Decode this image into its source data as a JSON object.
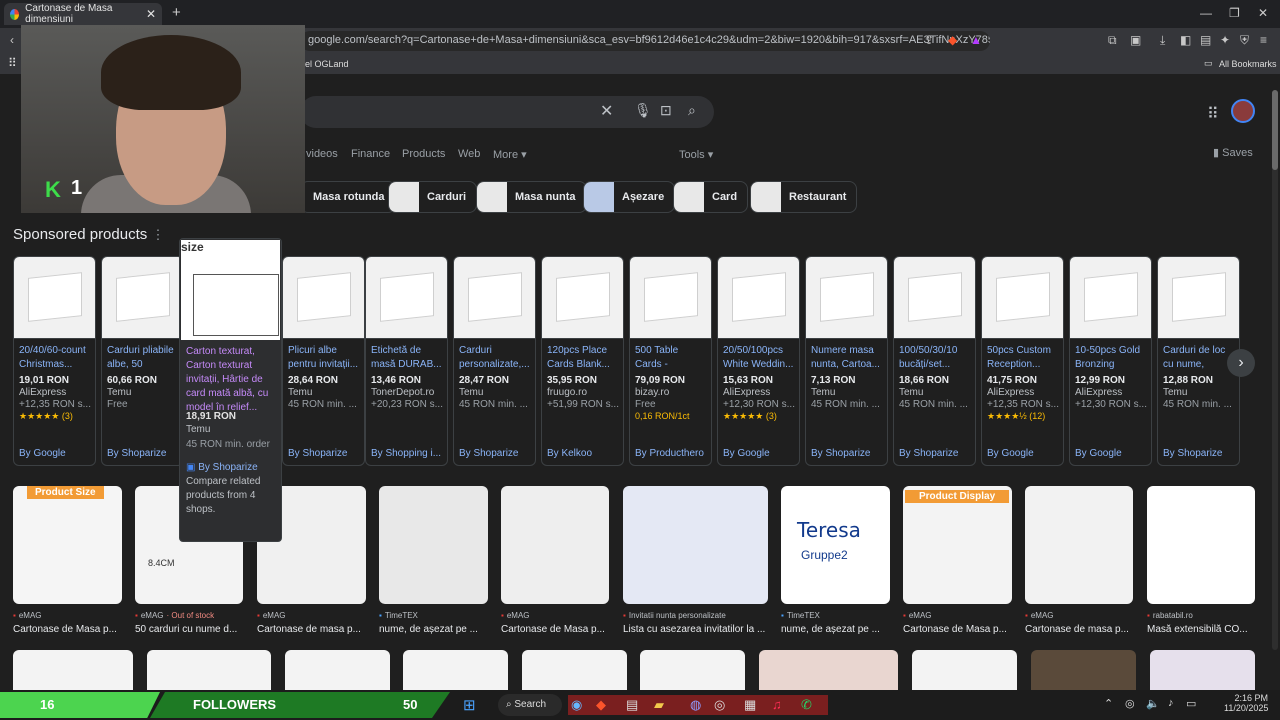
{
  "browser": {
    "tab_title": "Cartonase de Masa dimensiuni",
    "close": "✕",
    "new_tab": "+",
    "url": "google.com/search?q=Cartonase+de+Masa+dimensiuni&sca_esv=bf9612d46e1c4c29&udm=2&biw=1920&bih=917&sxsrf=AE3TifNnXzY785a-IQIX...",
    "bookmark": "el OGLand",
    "all_bookmarks": "All Bookmarks"
  },
  "filters": [
    "videos",
    "Finance",
    "Products",
    "Web",
    "More"
  ],
  "tools": "Tools",
  "saves": "Saves",
  "chips": [
    "Masa rotunda",
    "Carduri",
    "Masa nunta",
    "Așezare",
    "Card",
    "Restaurant"
  ],
  "sponsored_title": "Sponsored products",
  "popup": {
    "img_label": "size",
    "title": "Carton texturat, Carton texturat invitații, Hârtie de card mată albă, cu model în relief...",
    "price": "18,91 RON",
    "store": "Temu",
    "extra": "45 RON min. order",
    "by": "By Shoparize",
    "compare": "Compare related products from 4 shops."
  },
  "products": [
    {
      "title": "20/40/60-count Christmas...",
      "price": "19,01 RON",
      "store": "AliExpress",
      "extra": "+12,35 RON s...",
      "rating": "★★★★★ (3)",
      "by": "By Google"
    },
    {
      "title": "Carduri pliabile albe, 50 bucăți...",
      "price": "60,66 RON",
      "store": "Temu",
      "extra": "Free",
      "rating": "",
      "by": "By Shoparize"
    },
    {
      "title": "Plicuri albe pentru invitații...",
      "price": "28,64 RON",
      "store": "Temu",
      "extra": "45 RON min. ...",
      "rating": "",
      "by": "By Shoparize"
    },
    {
      "title": "Etichetă de masă DURAB...",
      "price": "13,46 RON",
      "store": "TonerDepot.ro",
      "extra": "+20,23 RON s...",
      "rating": "",
      "by": "By Shopping i..."
    },
    {
      "title": "Carduri personalizate,...",
      "price": "28,47 RON",
      "store": "Temu",
      "extra": "45 RON min. ...",
      "rating": "",
      "by": "By Shoparize"
    },
    {
      "title": "120pcs Place Cards Blank...",
      "price": "35,95 RON",
      "store": "fruugo.ro",
      "extra": "+51,99 RON s...",
      "rating": "",
      "by": "By Kelkoo"
    },
    {
      "title": "500 Table Cards - Cardstock...",
      "price": "79,09 RON",
      "store": "bizay.ro",
      "extra": "Free",
      "rating": "0,16 RON/1ct",
      "by": "By Producthero"
    },
    {
      "title": "20/50/100pcs White Weddin...",
      "price": "15,63 RON",
      "store": "AliExpress",
      "extra": "+12,30 RON s...",
      "rating": "★★★★★ (3)",
      "by": "By Google"
    },
    {
      "title": "Numere masa nunta, Cartoa...",
      "price": "7,13 RON",
      "store": "Temu",
      "extra": "45 RON min. ...",
      "rating": "",
      "by": "By Shoparize"
    },
    {
      "title": "100/50/30/10 bucăți/set...",
      "price": "18,66 RON",
      "store": "Temu",
      "extra": "45 RON min. ...",
      "rating": "",
      "by": "By Shoparize"
    },
    {
      "title": "50pcs Custom Reception...",
      "price": "41,75 RON",
      "store": "AliExpress",
      "extra": "+12,35 RON s...",
      "rating": "★★★★½ (12)",
      "by": "By Google"
    },
    {
      "title": "10-50pcs Gold Bronzing Nam...",
      "price": "12,99 RON",
      "store": "AliExpress",
      "extra": "+12,30 RON s...",
      "rating": "",
      "by": "By Google"
    },
    {
      "title": "Carduri de loc cu nume, 50/100...",
      "price": "12,88 RON",
      "store": "Temu",
      "extra": "45 RON min. ...",
      "rating": "",
      "by": "By Shoparize"
    }
  ],
  "grid": [
    {
      "source": "eMAG",
      "oos": "",
      "caption": "Cartonase de Masa p..."
    },
    {
      "source": "eMAG",
      "oos": "· Out of stock",
      "caption": "50 carduri cu nume d..."
    },
    {
      "source": "eMAG",
      "oos": "",
      "caption": "Cartonase de masa p..."
    },
    {
      "source": "TimeTEX",
      "oos": "",
      "caption": "nume, de așezat pe ..."
    },
    {
      "source": "eMAG",
      "oos": "",
      "caption": "Cartonase de Masa p..."
    },
    {
      "source": "Invitatii nunta personalizate",
      "oos": "",
      "caption": "Lista cu asezarea invitatilor la ..."
    },
    {
      "source": "TimeTEX",
      "oos": "",
      "caption": "nume, de așezat pe ..."
    },
    {
      "source": "eMAG",
      "oos": "",
      "caption": "Cartonase de Masa p..."
    },
    {
      "source": "eMAG",
      "oos": "",
      "caption": "Cartonase de masa p..."
    },
    {
      "source": "rabatabil.ro",
      "oos": "",
      "caption": "Masă extensibilă CO..."
    }
  ],
  "grid_labels": {
    "product_size": "Product Size",
    "dim": "8.4CM",
    "name": "Teresa",
    "group": "Gruppe2",
    "display": "Product Display"
  },
  "overlay": {
    "k_num": "1",
    "left_num": "16",
    "followers": "FOLLOWERS",
    "count": "50"
  },
  "taskbar": {
    "search": "Search",
    "time": "2:16 PM",
    "date": "11/20/2025"
  }
}
